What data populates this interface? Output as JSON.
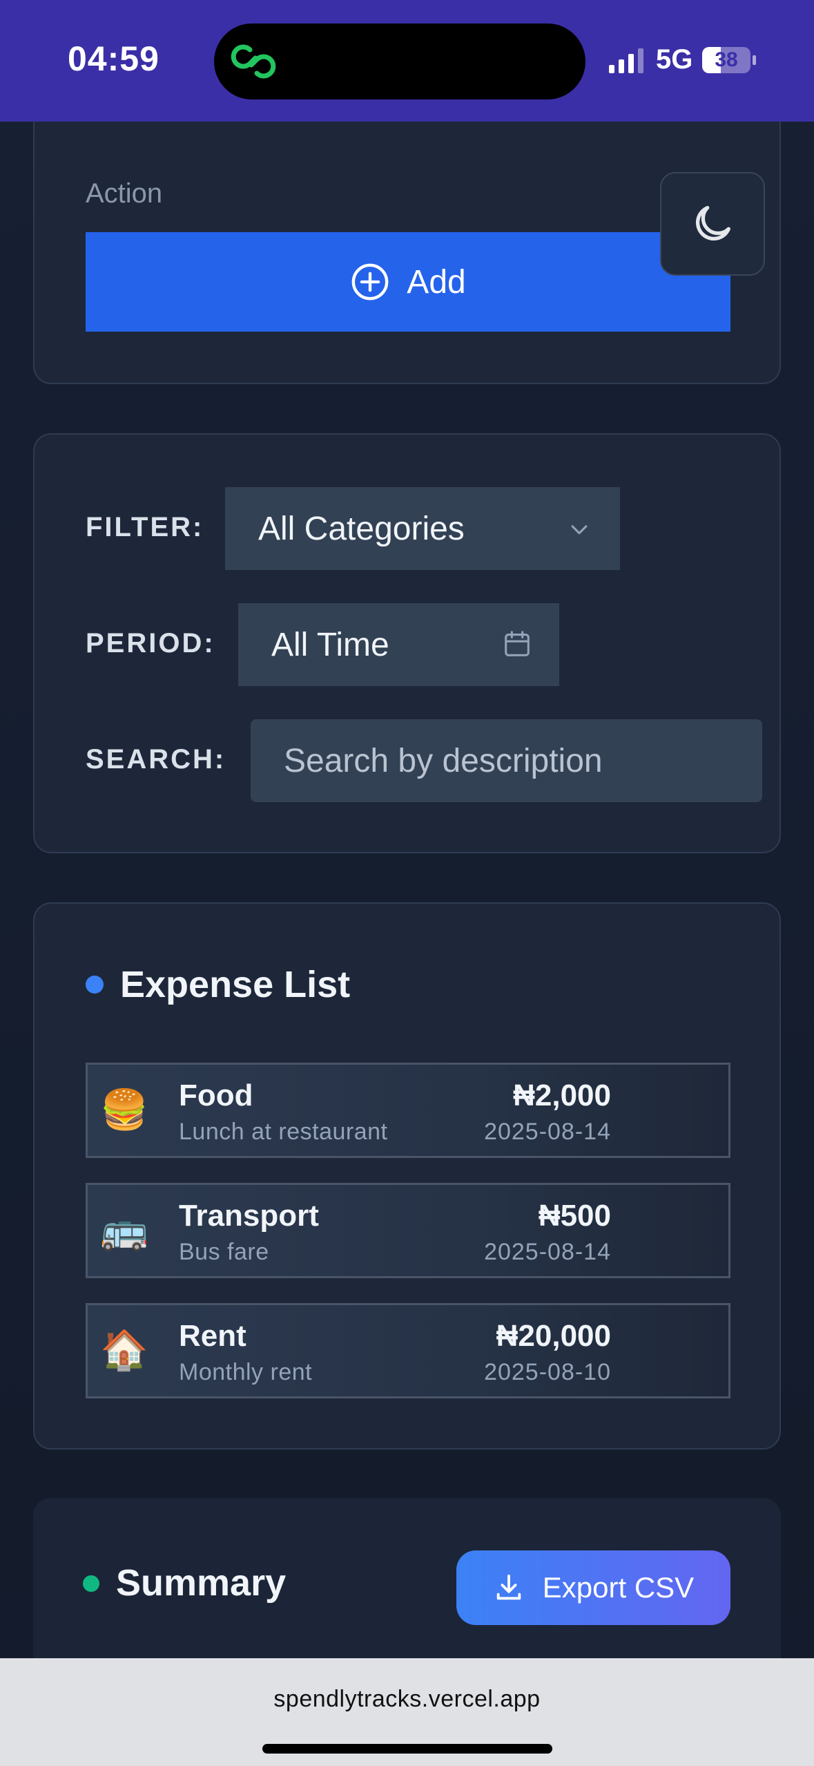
{
  "status_bar": {
    "time": "04:59",
    "network": "5G",
    "battery": "38",
    "battery_level": 0.38,
    "dynamic_island_icon": "link-chain-icon",
    "accent": "#3b2fa7"
  },
  "add_form": {
    "action_label": "Action",
    "add_button_label": "Add",
    "add_button_icon": "plus-circle-icon",
    "theme_toggle_icon": "moon-icon",
    "button_color": "#2563eb"
  },
  "filters": {
    "filter_label": "FILTER:",
    "category_value": "All Categories",
    "period_label": "PERIOD:",
    "period_value": "All Time",
    "search_label": "SEARCH:",
    "search_placeholder": "Search by description"
  },
  "expense_list": {
    "title": "Expense List",
    "dot_color": "#3b82f6",
    "items": [
      {
        "emoji": "🍔",
        "category": "Food",
        "description": "Lunch at restaurant",
        "amount": "₦2,000",
        "date": "2025-08-14"
      },
      {
        "emoji": "🚌",
        "category": "Transport",
        "description": "Bus fare",
        "amount": "₦500",
        "date": "2025-08-14"
      },
      {
        "emoji": "🏠",
        "category": "Rent",
        "description": "Monthly rent",
        "amount": "₦20,000",
        "date": "2025-08-10"
      }
    ]
  },
  "summary": {
    "title": "Summary",
    "dot_color": "#10b981",
    "export_label": "Export CSV",
    "export_icon": "download-icon"
  },
  "browser": {
    "url": "spendlytracks.vercel.app"
  }
}
